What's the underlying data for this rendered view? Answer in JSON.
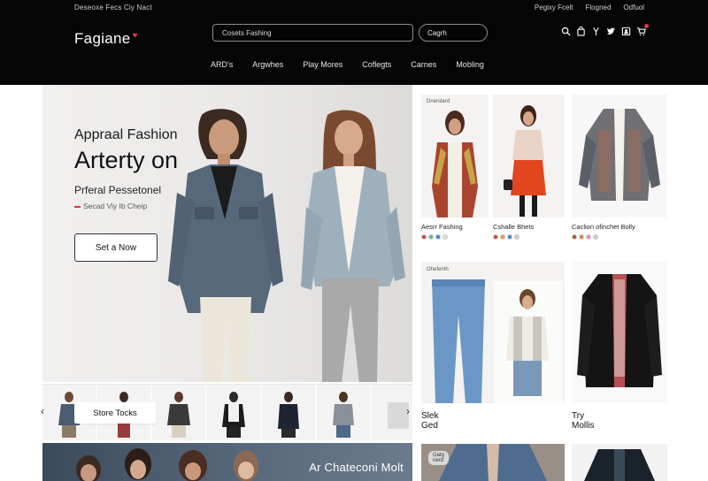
{
  "header": {
    "topbar_left": "Deseoxe Fecs Ciy Nact",
    "topbar_right": [
      "Pegixy Fcelt",
      "Flogned",
      "Odfuol"
    ],
    "logo": "Fagiane",
    "search": {
      "value": "Cosets Fashing",
      "button": "Cagrh"
    },
    "icons": [
      "search-icon",
      "bag-icon",
      "wishlist-icon",
      "twitter-icon",
      "account-icon",
      "cart-icon"
    ],
    "nav": [
      "ARD's",
      "Argwhes",
      "Play Mores",
      "Coflegts",
      "Carnes",
      "Mobling"
    ]
  },
  "hero": {
    "eyebrow": "Appraal Fashion",
    "title": "Arterty on",
    "subtitle": "Prferal Pessetonel",
    "tag": "Secad Viy Ib Cheip",
    "cta": "Set a Now"
  },
  "strip": {
    "overlay": "Store Tocks",
    "prev": "‹",
    "next": "›"
  },
  "banner": {
    "text": "Ar Chateconi Molt"
  },
  "products": {
    "row1": [
      {
        "tag": "Dnersterd",
        "label": "Aesrr Fashing",
        "swatches": [
          "#c44",
          "#6b8",
          "#48c",
          "#ddd"
        ]
      },
      {
        "label": "Cshalle Bhets",
        "swatches": [
          "#c44",
          "#e93",
          "#48c",
          "#ccc"
        ]
      },
      {
        "label": "Caclion ofinchet Bolly",
        "swatches": [
          "#a52",
          "#d84",
          "#e8c",
          "#ccc"
        ]
      }
    ],
    "row2": [
      {
        "tag": "Ohefenth",
        "label": "Slek Ged"
      },
      {
        "label": "Try Mollis"
      }
    ],
    "row3": [
      {
        "badge": "Gatg nerd"
      },
      {}
    ]
  },
  "colors": {
    "accent": "#e0314b",
    "header_bg": "#050505"
  }
}
